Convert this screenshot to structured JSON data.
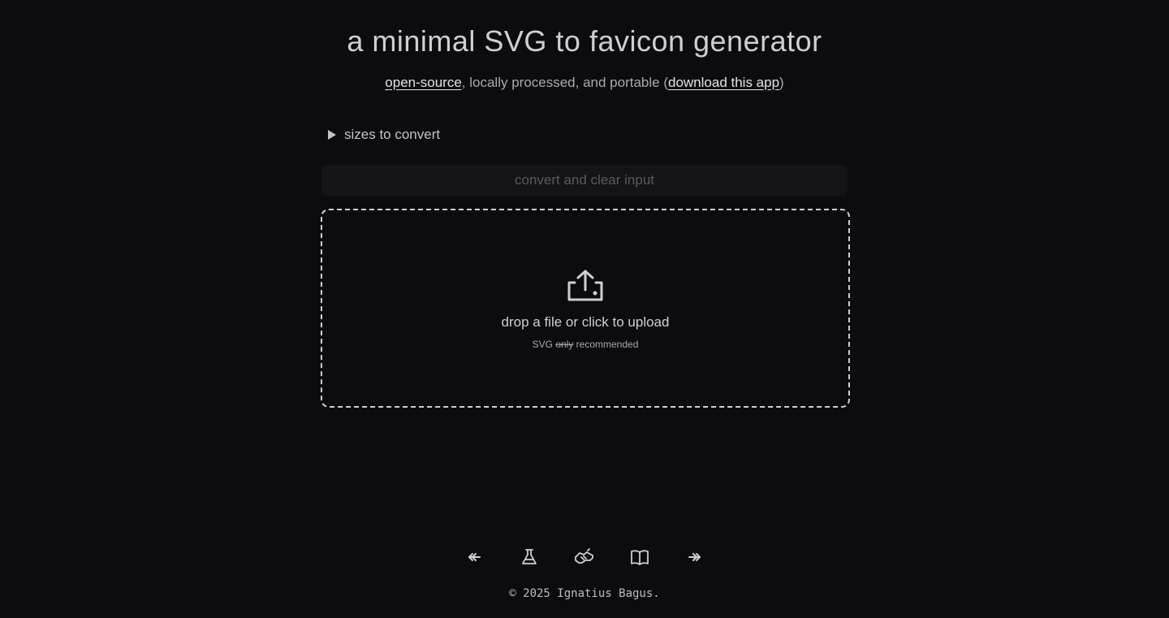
{
  "header": {
    "title": "a minimal SVG to favicon generator",
    "open_source_link": "open-source",
    "subtitle_middle": ", locally processed, and portable (",
    "download_link": "download this app",
    "subtitle_end": ")"
  },
  "settings": {
    "sizes_toggle_label": "sizes to convert"
  },
  "actions": {
    "convert_label": "convert and clear input"
  },
  "dropzone": {
    "icon": "upload-icon",
    "main_text": "drop a file or click to upload",
    "hint_prefix": "SVG ",
    "hint_struck": "only",
    "hint_suffix": " recommended"
  },
  "footer": {
    "nav_icons": [
      "arrow-left-icon",
      "flask-icon",
      "handshake-icon",
      "book-open-icon",
      "arrow-right-icon"
    ],
    "copyright": "© 2025 Ignatius Bagus."
  },
  "colors": {
    "background": "#0c0c0e",
    "text": "#c8c8ca",
    "button_bg": "#141416",
    "button_text": "#5a5a5d"
  }
}
